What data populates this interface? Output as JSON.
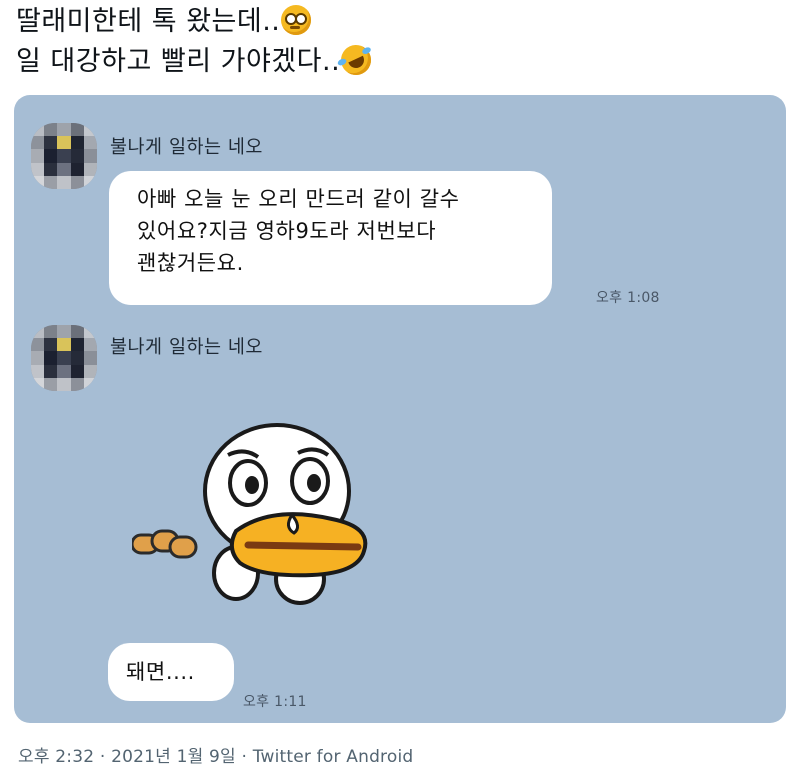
{
  "tweet": {
    "line1": "딸래미한테 톡 왔는데..",
    "line1_emoji": "flushed-face-icon",
    "line2": "일 대강하고 빨리 가야겠다..",
    "line2_emoji": "rolling-on-floor-laughing-icon"
  },
  "chat": {
    "background": "#a6bdd4",
    "messages": [
      {
        "sender": "불나게 일하는 네오",
        "lines": [
          "아빠 오늘 눈 오리 만드러 같이 갈수",
          "있어요?지금 영하9도라  저번보다",
          "괜찮거든요."
        ],
        "time": "오후 1:08"
      },
      {
        "sender": "불나게 일하는 네오",
        "sticker": "crying-duck-sticker",
        "text": "돼면....",
        "time": "오후 1:11"
      }
    ]
  },
  "meta": {
    "text": "오후 2:32 · 2021년 1월 9일 · Twitter for Android"
  }
}
